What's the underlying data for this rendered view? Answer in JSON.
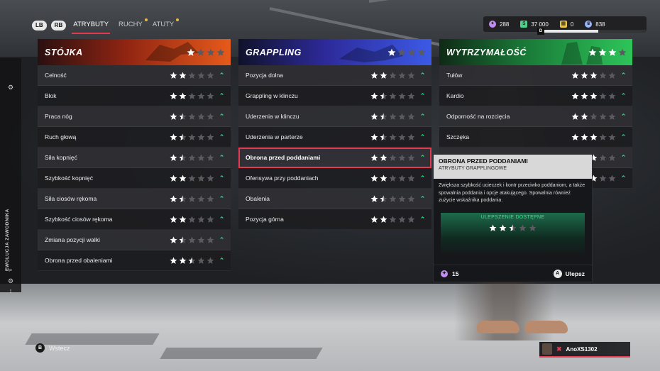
{
  "nav": {
    "lb": "LB",
    "rb": "RB",
    "tabs": [
      {
        "label": "ATRYBUTY",
        "active": true,
        "dot": false
      },
      {
        "label": "RUCHY",
        "active": false,
        "dot": true
      },
      {
        "label": "ATUTY",
        "active": false,
        "dot": true
      }
    ]
  },
  "currency": {
    "points": "288",
    "coins": "37 000",
    "tokens": "0",
    "level_count": "838",
    "xp_progress": 0.55,
    "xp_badge": "D"
  },
  "rail": {
    "label": "EWOLUCJA ZAWODNIKA"
  },
  "columns": [
    {
      "title": "STÓJKA",
      "theme": "red",
      "head_stars": 1,
      "rows": [
        {
          "label": "Celność",
          "stars": 2
        },
        {
          "label": "Blok",
          "stars": 2
        },
        {
          "label": "Praca nóg",
          "stars": 1.5
        },
        {
          "label": "Ruch głową",
          "stars": 1.5
        },
        {
          "label": "Siła kopnięć",
          "stars": 1.5
        },
        {
          "label": "Szybkość kopnięć",
          "stars": 2
        },
        {
          "label": "Siła ciosów rękoma",
          "stars": 1.5
        },
        {
          "label": "Szybkość ciosów rękoma",
          "stars": 2
        },
        {
          "label": "Zmiana pozycji walki",
          "stars": 1.5
        },
        {
          "label": "Obrona przed obaleniami",
          "stars": 2.5
        }
      ]
    },
    {
      "title": "GRAPPLING",
      "theme": "blue",
      "head_stars": 1,
      "rows": [
        {
          "label": "Pozycja dolna",
          "stars": 2
        },
        {
          "label": "Grappling w klinczu",
          "stars": 1.5
        },
        {
          "label": "Uderzenia w klinczu",
          "stars": 1.5
        },
        {
          "label": "Uderzenia w parterze",
          "stars": 1.5
        },
        {
          "label": "Obrona przed poddaniami",
          "stars": 2,
          "selected": true
        },
        {
          "label": "Ofensywa przy poddaniach",
          "stars": 2
        },
        {
          "label": "Obalenia",
          "stars": 1.5
        },
        {
          "label": "Pozycja górna",
          "stars": 2
        }
      ]
    },
    {
      "title": "WYTRZYMAŁOŚĆ",
      "theme": "green",
      "head_stars": 3,
      "rows": [
        {
          "label": "Tułów",
          "stars": 3
        },
        {
          "label": "Kardio",
          "stars": 3
        },
        {
          "label": "Odporność na rozcięcia",
          "stars": 2
        },
        {
          "label": "Szczęka",
          "stars": 3
        },
        {
          "label": "",
          "stars": 3
        },
        {
          "label": "",
          "stars": 3
        }
      ]
    }
  ],
  "tooltip": {
    "title": "OBRONA PRZED PODDANIAMI",
    "subtitle": "ATRYBUTY GRAPPLINGOWE",
    "description": "Zwiększa szybkość ucieczek i kontr przeciwko poddaniom, a także spowalnia poddania i opcje atakującego. Spowalnia również zużycie wskaźnika poddania.",
    "upgrade_label": "ULEPSZENIE DOSTĘPNE",
    "upgrade_stars": 2.5,
    "cost": "15",
    "action_button": "A",
    "action_label": "Ulepsz"
  },
  "footer": {
    "back_button": "B",
    "back_label": "Wstecz",
    "player_name": "AnoXS1302"
  },
  "colors": {
    "accent_red": "#e23a4f",
    "upgrade_green": "#2fe08a",
    "star_filled": "#ffffff",
    "star_empty": "#5a5a60"
  }
}
